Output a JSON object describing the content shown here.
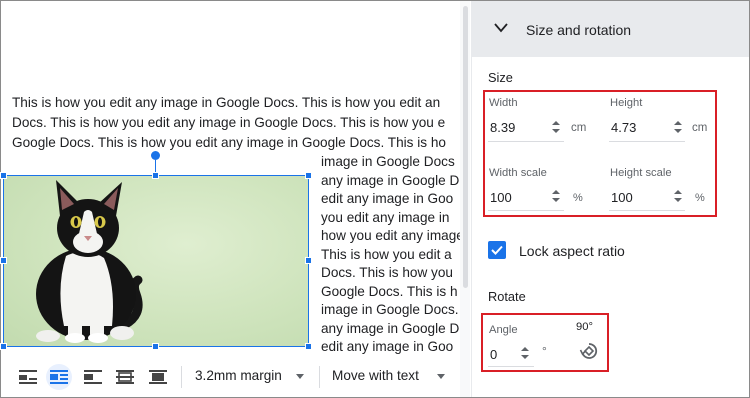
{
  "document": {
    "lines": [
      "This is how you edit any image in Google Docs. This is how you edit an",
      "Docs. This is how you edit any image in Google Docs. This is how you e",
      "Google Docs. This is how you edit any image in Google Docs. This is ho"
    ],
    "wrap_lines": [
      "image in Google Docs",
      "any image in Google D",
      "edit any image in Goo",
      "you edit any image in",
      "how you edit any image",
      "This is how you edit a",
      "Docs. This is how you",
      "Google Docs. This is h",
      "image in Google Docs.",
      "any image in Google D",
      "edit any image in Goo"
    ]
  },
  "image_toolbar": {
    "margin_label": "3.2mm margin",
    "wrap_label": "Move with text",
    "icons": [
      "inline-icon",
      "wrap-text-icon",
      "break-text-icon",
      "behind-text-icon",
      "in-front-of-text-icon"
    ]
  },
  "panel": {
    "title": "Size and rotation",
    "size_section": "Size",
    "width_label": "Width",
    "width_value": "8.39",
    "width_unit": "cm",
    "height_label": "Height",
    "height_value": "4.73",
    "height_unit": "cm",
    "width_scale_label": "Width scale",
    "width_scale_value": "100",
    "width_scale_unit": "%",
    "height_scale_label": "Height scale",
    "height_scale_value": "100",
    "height_scale_unit": "%",
    "lock_label": "Lock aspect ratio",
    "lock_checked": true,
    "rotate_section": "Rotate",
    "angle_label": "Angle",
    "angle_value": "0",
    "angle_unit": "°",
    "rotate90_label": "90°"
  },
  "colors": {
    "accent": "#1a73e8",
    "highlight_box": "#d91f26"
  }
}
